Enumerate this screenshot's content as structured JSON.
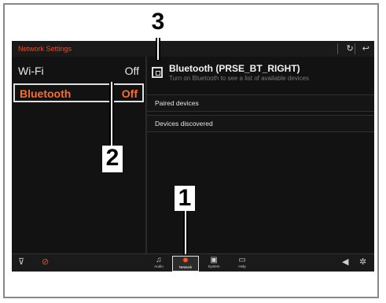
{
  "header": {
    "title": "Network Settings",
    "refresh_icon": "refresh-icon",
    "back_icon": "back-icon"
  },
  "left": {
    "items": [
      {
        "label": "Wi-Fi",
        "value": "Off"
      },
      {
        "label": "Bluetooth",
        "value": "Off"
      }
    ]
  },
  "right": {
    "bt_name": "Bluetooth (PRSE_BT_RIGHT)",
    "bt_desc": "Turn on Bluetooth to see a list of available devices",
    "sections": [
      "Paired devices",
      "Devices discovered"
    ]
  },
  "bottom": {
    "tabs": [
      {
        "label": "Audio",
        "icon": "music-icon"
      },
      {
        "label": "Network",
        "icon": "network-icon"
      },
      {
        "label": "System",
        "icon": "system-icon"
      },
      {
        "label": "Help",
        "icon": "help-icon"
      }
    ]
  },
  "callouts": [
    "1",
    "2",
    "3"
  ],
  "colors": {
    "accent": "#ff6a2c",
    "background": "#0f0f0f",
    "text": "#e8e8e8"
  }
}
